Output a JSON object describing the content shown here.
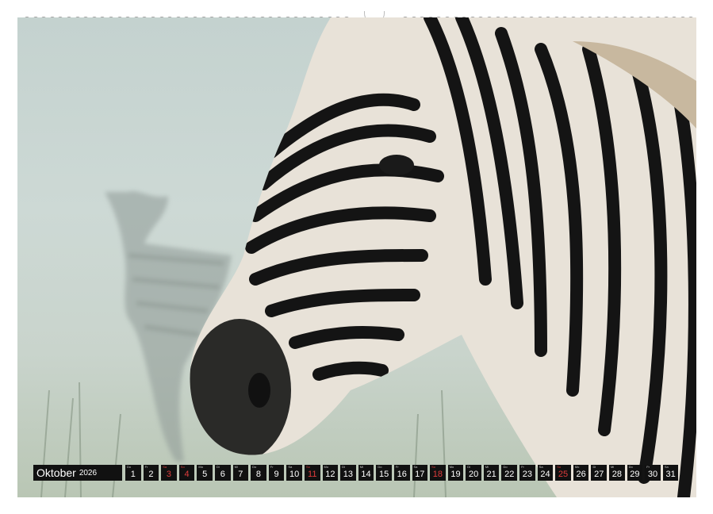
{
  "calendar": {
    "month": "Oktober",
    "year": "2026",
    "days": [
      {
        "wd": "Do",
        "num": "1",
        "red": false
      },
      {
        "wd": "Fr",
        "num": "2",
        "red": false
      },
      {
        "wd": "Sa",
        "num": "3",
        "red": true
      },
      {
        "wd": "So",
        "num": "4",
        "red": true
      },
      {
        "wd": "Mo",
        "num": "5",
        "red": false
      },
      {
        "wd": "Di",
        "num": "6",
        "red": false
      },
      {
        "wd": "Mi",
        "num": "7",
        "red": false
      },
      {
        "wd": "Do",
        "num": "8",
        "red": false
      },
      {
        "wd": "Fr",
        "num": "9",
        "red": false
      },
      {
        "wd": "Sa",
        "num": "10",
        "red": false
      },
      {
        "wd": "So",
        "num": "11",
        "red": true
      },
      {
        "wd": "Mo",
        "num": "12",
        "red": false
      },
      {
        "wd": "Di",
        "num": "13",
        "red": false
      },
      {
        "wd": "Mi",
        "num": "14",
        "red": false
      },
      {
        "wd": "Do",
        "num": "15",
        "red": false
      },
      {
        "wd": "Fr",
        "num": "16",
        "red": false
      },
      {
        "wd": "Sa",
        "num": "17",
        "red": false
      },
      {
        "wd": "So",
        "num": "18",
        "red": true
      },
      {
        "wd": "Mo",
        "num": "19",
        "red": false
      },
      {
        "wd": "Di",
        "num": "20",
        "red": false
      },
      {
        "wd": "Mi",
        "num": "21",
        "red": false
      },
      {
        "wd": "Do",
        "num": "22",
        "red": false
      },
      {
        "wd": "Fr",
        "num": "23",
        "red": false
      },
      {
        "wd": "Sa",
        "num": "24",
        "red": false
      },
      {
        "wd": "So",
        "num": "25",
        "red": true
      },
      {
        "wd": "Mo",
        "num": "26",
        "red": false
      },
      {
        "wd": "Di",
        "num": "27",
        "red": false
      },
      {
        "wd": "Mi",
        "num": "28",
        "red": false
      },
      {
        "wd": "Do",
        "num": "29",
        "red": false
      },
      {
        "wd": "Fr",
        "num": "30",
        "red": false
      },
      {
        "wd": "Sa",
        "num": "31",
        "red": false
      }
    ]
  },
  "colors": {
    "cell_bg": "#111111",
    "cell_text": "#ffffff",
    "sunday_text": "#e03c3c"
  }
}
